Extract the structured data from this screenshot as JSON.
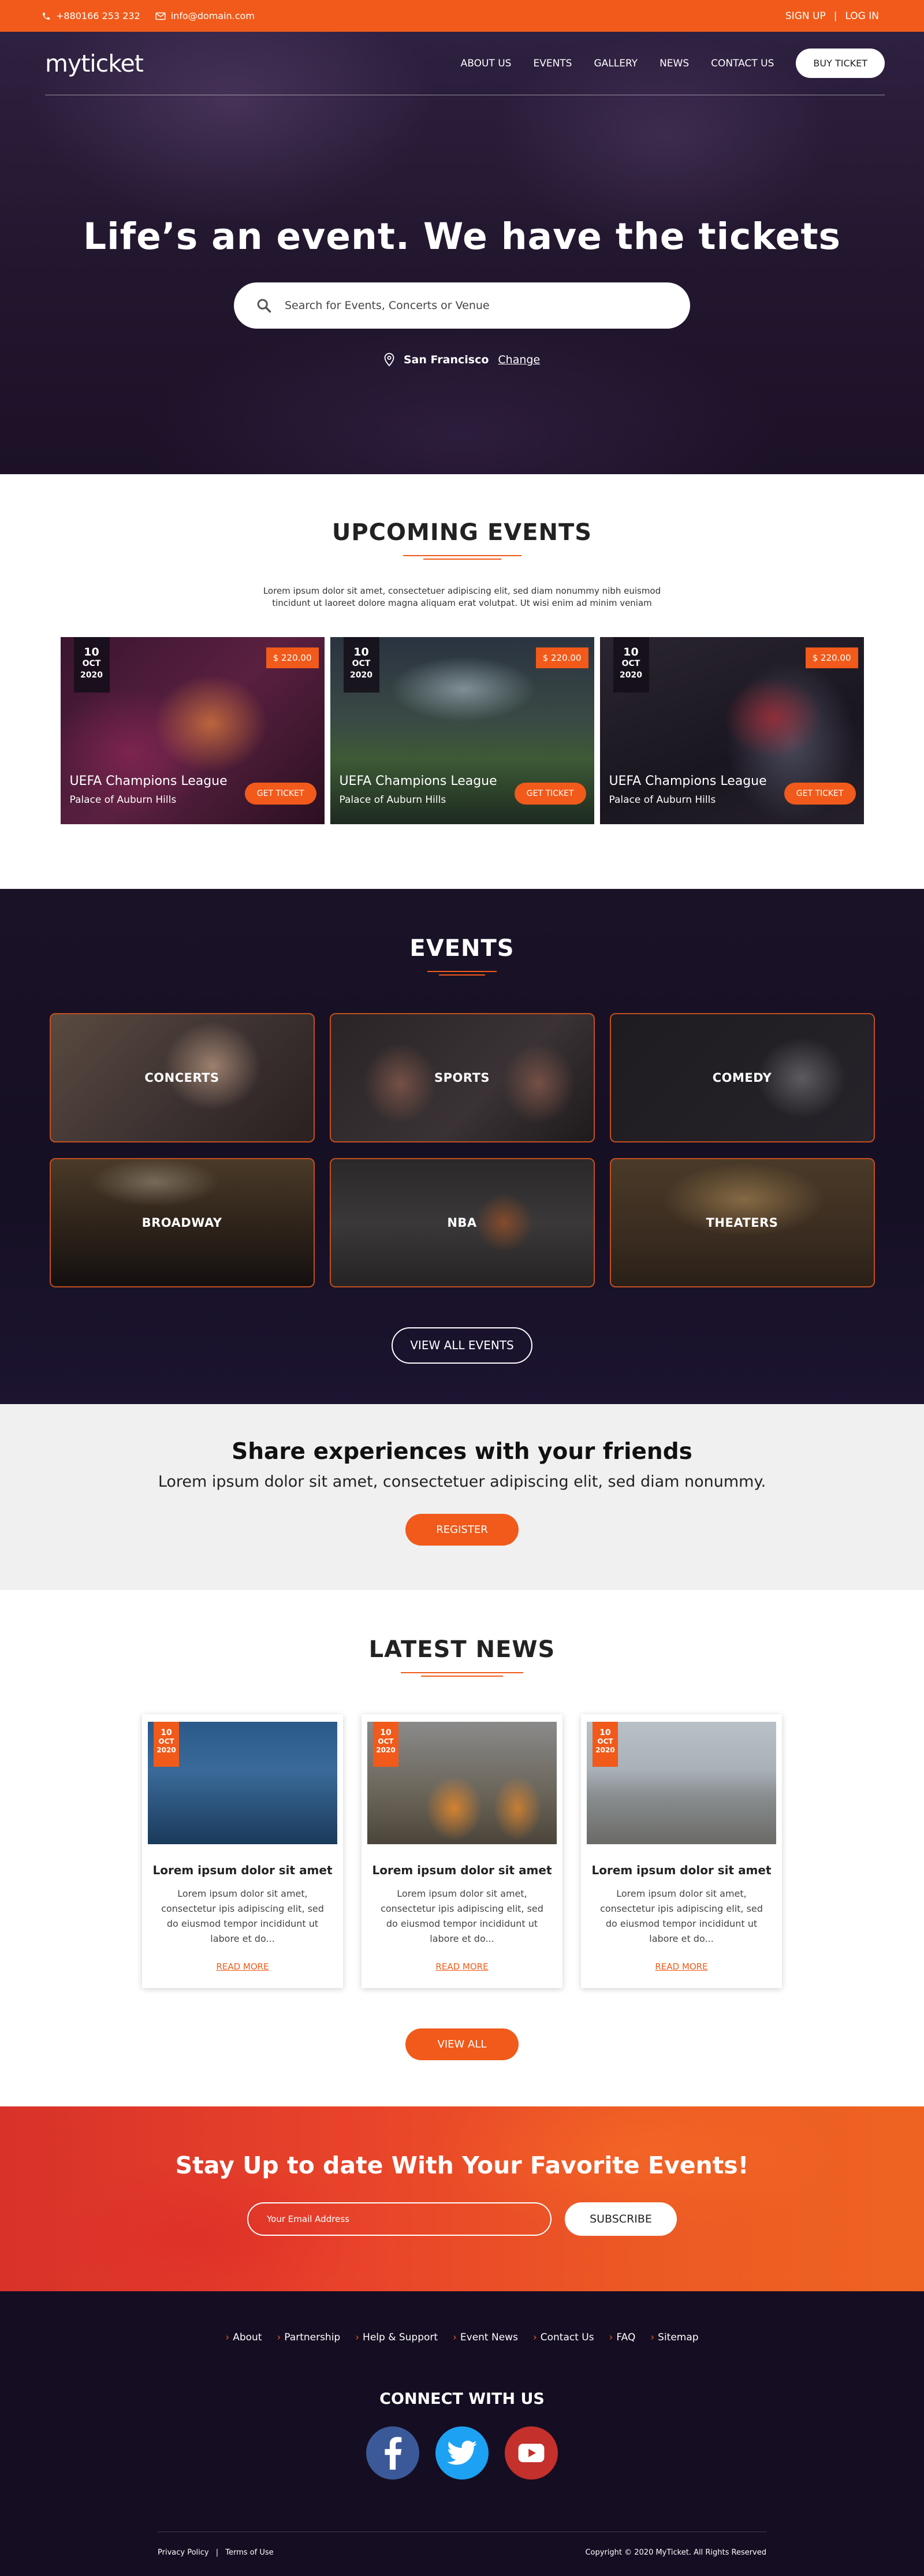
{
  "topbar": {
    "phone": "+880166 253 232",
    "email": "info@domain.com",
    "signup": "SIGN UP",
    "sep": "|",
    "login": "LOG IN"
  },
  "nav": {
    "logo": "myticket",
    "items": [
      "ABOUT US",
      "EVENTS",
      "GALLERY",
      "NEWS",
      "CONTACT US"
    ],
    "buy": "BUY TICKET"
  },
  "hero": {
    "title": "Life’s an event. We have the tickets",
    "search_placeholder": "Search for Events, Concerts or Venue",
    "city": "San Francisco",
    "change": "Change"
  },
  "upcoming": {
    "title": "UPCOMING EVENTS",
    "desc": "Lorem ipsum dolor sit amet, consectetuer adipiscing elit, sed diam nonummy nibh euismod tincidunt ut laoreet dolore magna aliquam erat volutpat. Ut wisi enim ad minim veniam",
    "cards": [
      {
        "day": "10",
        "month": "OCT",
        "year": "2020",
        "price": "$ 220.00",
        "title": "UEFA Champions League",
        "venue": "Palace of Auburn Hills",
        "btn": "GET TICKET"
      },
      {
        "day": "10",
        "month": "OCT",
        "year": "2020",
        "price": "$ 220.00",
        "title": "UEFA Champions League",
        "venue": "Palace of Auburn Hills",
        "btn": "GET TICKET"
      },
      {
        "day": "10",
        "month": "OCT",
        "year": "2020",
        "price": "$ 220.00",
        "title": "UEFA Champions League",
        "venue": "Palace of Auburn Hills",
        "btn": "GET TICKET"
      }
    ]
  },
  "events": {
    "title": "EVENTS",
    "categories": [
      "CONCERTS",
      "SPORTS",
      "COMEDY",
      "BROADWAY",
      "NBA",
      "THEATERS"
    ],
    "view_all": "VIEW ALL EVENTS"
  },
  "share": {
    "title": "Share experiences with your friends",
    "text": "Lorem ipsum dolor sit amet, consectetuer adipiscing elit, sed diam nonummy.",
    "btn": "REGISTER"
  },
  "news": {
    "title": "LATEST NEWS",
    "items": [
      {
        "day": "10",
        "month": "OCT",
        "year": "2020",
        "title": "Lorem ipsum dolor sit amet",
        "text": "Lorem ipsum dolor sit amet, consectetur ipis adipiscing elit, sed do eiusmod tempor incididunt ut labore et do...",
        "link": "READ MORE"
      },
      {
        "day": "10",
        "month": "OCT",
        "year": "2020",
        "title": "Lorem ipsum dolor sit amet",
        "text": "Lorem ipsum dolor sit amet, consectetur ipis adipiscing elit, sed do eiusmod tempor incididunt ut labore et do...",
        "link": "READ MORE"
      },
      {
        "day": "10",
        "month": "OCT",
        "year": "2020",
        "title": "Lorem ipsum dolor sit amet",
        "text": "Lorem ipsum dolor sit amet, consectetur ipis adipiscing elit, sed do eiusmod tempor incididunt ut labore et do...",
        "link": "READ MORE"
      }
    ],
    "view_all": "VIEW ALL"
  },
  "subscribe": {
    "title": "Stay Up to date With Your Favorite Events!",
    "placeholder": "Your Email Address",
    "btn": "SUBSCRIBE"
  },
  "footer": {
    "links": [
      "About",
      "Partnership",
      "Help & Support",
      "Event News",
      "Contact Us",
      "FAQ",
      "Sitemap"
    ],
    "connect": "CONNECT WITH US",
    "privacy": "Privacy Policy",
    "sep": "|",
    "terms": "Terms of Use",
    "copyright": "Copyright © 2020 MyTicket. All Rights Reserved"
  },
  "colors": {
    "accent": "#f15a1a",
    "dark": "#150d22",
    "facebook": "#3b5998",
    "twitter": "#1da1f2",
    "youtube": "#c4302b"
  }
}
